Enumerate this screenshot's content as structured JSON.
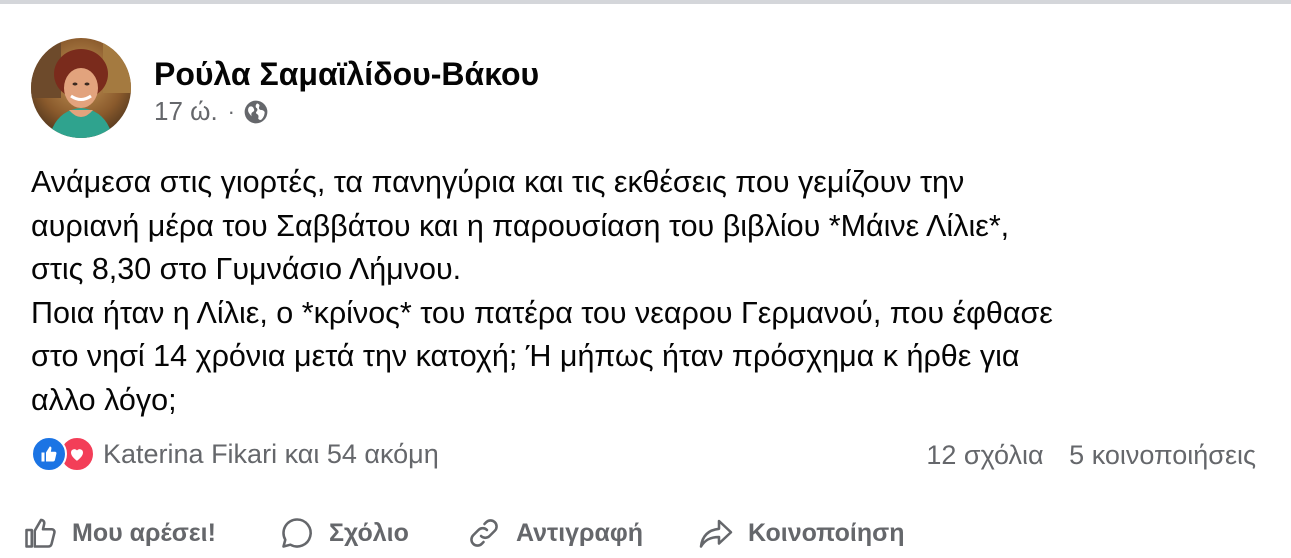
{
  "post": {
    "author": "Ρούλα Σαμαϊλίδου-Βάκου",
    "time": "17 ώ.",
    "separator": "·",
    "privacy_icon": "globe-icon",
    "text_lines": [
      "Ανάμεσα στις γιορτές, τα πανηγύρια και τις εκθέσεις που γεμίζουν την",
      "αυριανή μέρα του Σαββάτου και η παρουσίαση του βιβλίου *Μάινε Λίλιε*,",
      "στις 8,30 στο Γυμνάσιο Λήμνου.",
      "Ποια ήταν η Λίλιε, ο *κρίνος* του πατέρα του νεαρου Γερμανού, που έφθασε",
      "στο νησί 14 χρόνια μετά την κατοχή;  Ή μήπως ήταν πρόσχημα κ ήρθε για",
      "αλλο λόγο;"
    ]
  },
  "engagement": {
    "reaction_icons": [
      "like-icon",
      "love-icon"
    ],
    "reactions_text": "Katerina Fikari και 54 ακόμη",
    "comments": "12 σχόλια",
    "shares": "5 κοινοποιήσεις"
  },
  "actions": {
    "like": "Μου αρέσει!",
    "comment": "Σχόλιο",
    "copy": "Αντιγραφή",
    "share": "Κοινοποίηση"
  },
  "colors": {
    "primary_text": "#050505",
    "secondary_text": "#65676b",
    "like_blue": "#1b74e4",
    "love_red": "#f33e58"
  }
}
